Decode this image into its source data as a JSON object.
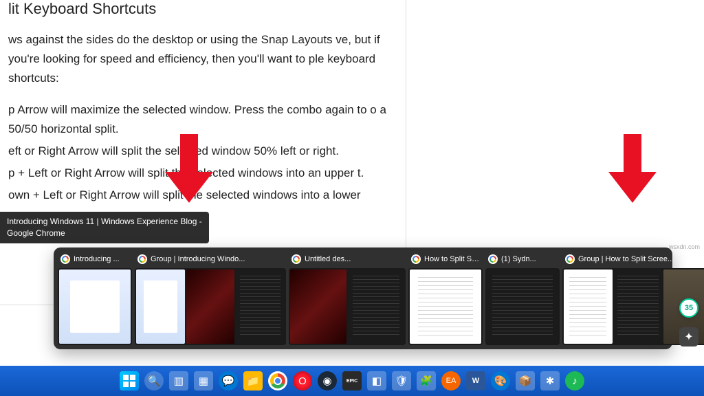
{
  "article": {
    "heading": "lit Keyboard Shortcuts",
    "para": "ws against the sides do the desktop or using the Snap Layouts ve, but if you're looking for speed and efficiency, then you'll want to ple keyboard shortcuts:",
    "b1": "p Arrow will maximize the selected window. Press the combo again to o a 50/50 horizontal split.",
    "b2": "eft or Right Arrow will split the selected window 50% left or right.",
    "b3": "p + Left or Right Arrow will split the selected windows into an upper t.",
    "b4": "own + Left or Right Arrow will split the selected windows into a lower"
  },
  "tooltip": {
    "line1": "Introducing Windows 11 | Windows Experience Blog -",
    "line2": "Google Chrome"
  },
  "switcher": [
    {
      "title": "Introducing ...",
      "panes": [
        "light"
      ]
    },
    {
      "title": "Group | Introducing Windo...",
      "panes": [
        "light",
        "red",
        "dark"
      ]
    },
    {
      "title": "Untitled des...",
      "panes": [
        "red",
        "dark"
      ]
    },
    {
      "title": "How to Split Scree...",
      "panes": [
        "doc"
      ]
    },
    {
      "title": "(1) Sydn...",
      "panes": [
        "dark"
      ]
    },
    {
      "title": "Group | How to Split Scree...",
      "panes": [
        "doc",
        "dark",
        "vid"
      ]
    }
  ],
  "taskbar": {
    "items": [
      {
        "name": "start",
        "kind": "start"
      },
      {
        "name": "search",
        "kind": "search",
        "glyph": "🔍"
      },
      {
        "name": "task-view",
        "kind": "generic",
        "glyph": "▥"
      },
      {
        "name": "widgets",
        "kind": "generic",
        "glyph": "▦"
      },
      {
        "name": "chat",
        "kind": "blue",
        "glyph": "💬"
      },
      {
        "name": "explorer",
        "kind": "folder",
        "glyph": "📁"
      },
      {
        "name": "chrome",
        "kind": "chrome"
      },
      {
        "name": "opera",
        "kind": "opera",
        "glyph": "O"
      },
      {
        "name": "steam",
        "kind": "steam",
        "glyph": "◉"
      },
      {
        "name": "epic",
        "kind": "epic",
        "glyph": "EPIC"
      },
      {
        "name": "app1",
        "kind": "generic",
        "glyph": "◧"
      },
      {
        "name": "app2",
        "kind": "generic",
        "glyph": "🛡"
      },
      {
        "name": "app3",
        "kind": "generic",
        "glyph": "🧩"
      },
      {
        "name": "ea",
        "kind": "orange",
        "glyph": "EA"
      },
      {
        "name": "word",
        "kind": "word",
        "glyph": "W"
      },
      {
        "name": "app4",
        "kind": "blue",
        "glyph": "🎨"
      },
      {
        "name": "app5",
        "kind": "generic",
        "glyph": "📦"
      },
      {
        "name": "slack",
        "kind": "generic",
        "glyph": "✱"
      },
      {
        "name": "spotify",
        "kind": "spotify",
        "glyph": "♪"
      }
    ]
  },
  "badge": {
    "value": "35"
  },
  "watermark": "wsxdn.com"
}
